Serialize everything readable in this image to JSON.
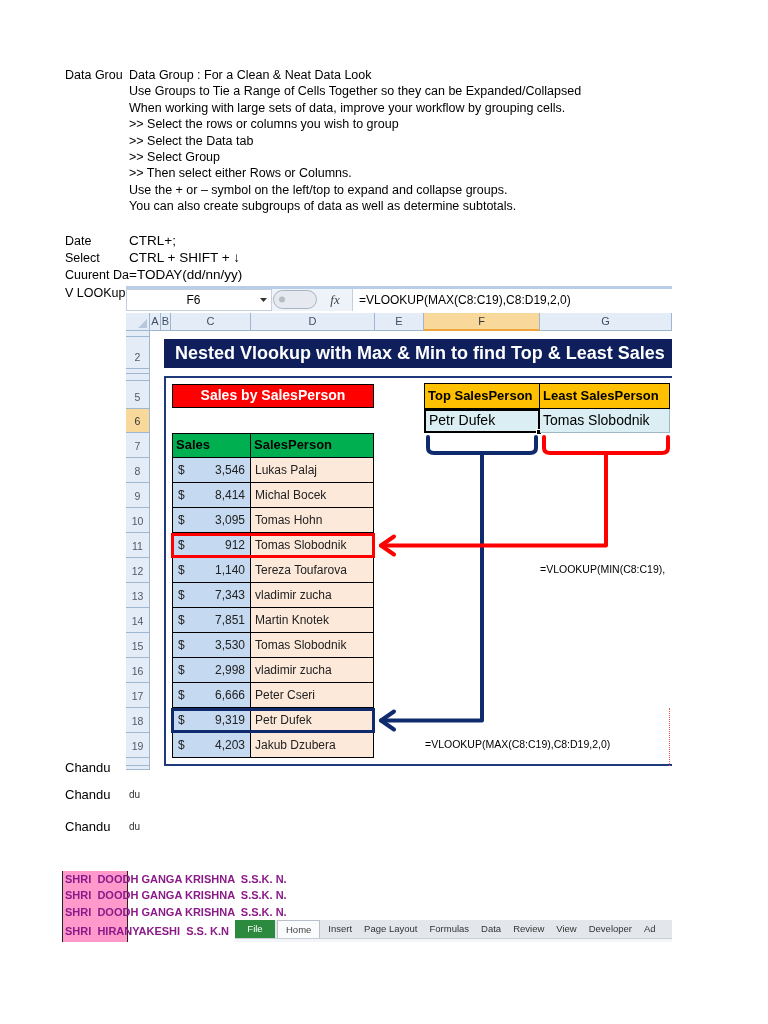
{
  "notes": {
    "label": "Data Grou",
    "lines": [
      "Data Group : For a Clean & Neat Data Look",
      "Use Groups to Tie a Range of Cells Together so they can be Expanded/Collapsed",
      "When working with large sets of data, improve your workflow by grouping cells.",
      ">> Select the rows or columns you wish to group",
      ">> Select the Data tab",
      ">> Select Group",
      ">> Then select either Rows or Columns.",
      "Use the + or – symbol on the left/top to expand and collapse groups.",
      "You can also create subgroups of data as well as determine subtotals."
    ]
  },
  "shortcuts": [
    {
      "label": "Date",
      "value": "CTRL+;"
    },
    {
      "label": "Select",
      "value": "CTRL + SHIFT + ↓"
    },
    {
      "label": "Cuurent Da",
      "value": "=TODAY(dd/nn/yy)"
    }
  ],
  "vlookup_label": "V LOOKup",
  "spreadsheet": {
    "name_box": "F6",
    "function_button": "fx",
    "formula": "=VLOOKUP(MAX(C8:C19),C8:D19,2,0)",
    "column_headers": [
      {
        "label": "A",
        "selected": false
      },
      {
        "label": "B",
        "selected": false
      },
      {
        "label": "C",
        "selected": false
      },
      {
        "label": "D",
        "selected": false
      },
      {
        "label": "E",
        "selected": false
      },
      {
        "label": "F",
        "selected": true
      },
      {
        "label": "G",
        "selected": false
      }
    ],
    "row_headers": [
      {
        "selected": false
      },
      {
        "label": "2",
        "selected": false
      },
      {
        "selected": false
      },
      {
        "selected": false
      },
      {
        "label": "5",
        "selected": false
      },
      {
        "label": "6",
        "selected": true
      },
      {
        "label": "7",
        "selected": false
      },
      {
        "label": "8",
        "selected": false
      },
      {
        "label": "9",
        "selected": false
      },
      {
        "label": "10",
        "selected": false
      },
      {
        "label": "11",
        "selected": false
      },
      {
        "label": "12",
        "selected": false
      },
      {
        "label": "13",
        "selected": false
      },
      {
        "label": "14",
        "selected": false
      },
      {
        "label": "15",
        "selected": false
      },
      {
        "label": "16",
        "selected": false
      },
      {
        "label": "17",
        "selected": false
      },
      {
        "label": "18",
        "selected": false
      },
      {
        "label": "19",
        "selected": false
      },
      {
        "selected": false
      },
      {
        "selected": false
      }
    ],
    "title": "Nested Vlookup with Max & Min to find Top & Least Sales",
    "table_title": "Sales by SalesPerson",
    "table_columns": [
      "Sales",
      "SalesPerson"
    ],
    "rows": [
      {
        "kind": "plain",
        "currency": "$",
        "sales": "3,546",
        "person": "Lukas Palaj"
      },
      {
        "kind": "plain",
        "currency": "$",
        "sales": "8,414",
        "person": "Michal Bocek"
      },
      {
        "kind": "plain",
        "currency": "$",
        "sales": "3,095",
        "person": "Tomas Hohn"
      },
      {
        "kind": "min",
        "currency": "$",
        "sales": "912",
        "person": "Tomas Slobodnik"
      },
      {
        "kind": "plain",
        "currency": "$",
        "sales": "1,140",
        "person": "Tereza Toufarova"
      },
      {
        "kind": "plain",
        "currency": "$",
        "sales": "7,343",
        "person": "vladimir zucha"
      },
      {
        "kind": "plain",
        "currency": "$",
        "sales": "7,851",
        "person": "Martin Knotek"
      },
      {
        "kind": "plain",
        "currency": "$",
        "sales": "3,530",
        "person": "Tomas Slobodnik"
      },
      {
        "kind": "plain",
        "currency": "$",
        "sales": "2,998",
        "person": "vladimir zucha"
      },
      {
        "kind": "plain",
        "currency": "$",
        "sales": "6,666",
        "person": "Peter Cseri"
      },
      {
        "kind": "max",
        "currency": "$",
        "sales": "9,319",
        "person": "Petr Dufek"
      },
      {
        "kind": "plain",
        "currency": "$",
        "sales": "4,203",
        "person": "Jakub Dzubera"
      }
    ],
    "results": [
      {
        "kind": "max",
        "header": "Top SalesPerson",
        "value": "Petr Dufek",
        "selected": true
      },
      {
        "kind": "min",
        "header": "Least SalesPerson",
        "value": "Tomas Slobodnik",
        "selected": false
      }
    ],
    "notes": [
      "=VLOOKUP(MIN(C8:C19),",
      "=VLOOKUP(MAX(C8:C19),C8:D19,2,0)"
    ]
  },
  "footer_rows": [
    {
      "label": "Chandu"
    },
    {
      "label": "Chandu",
      "note": "du"
    },
    {
      "label": "Chandu",
      "note": "du"
    }
  ],
  "highlight_list": [
    "SHRI  DOODH GANGA KRISHNA  S.S.K. N.",
    "SHRI  DOODH GANGA KRISHNA  S.S.K. N.",
    "SHRI  DOODH GANGA KRISHNA  S.S.K. N.",
    "SHRI  HIRANYAKESHI  S.S. K.N"
  ],
  "ribbon": {
    "tabs": [
      {
        "label": "File",
        "kind": "file",
        "selected": false
      },
      {
        "label": "Home",
        "kind": "tab",
        "selected": true
      },
      {
        "label": "Insert",
        "kind": "tab",
        "selected": false
      },
      {
        "label": "Page Layout",
        "kind": "tab",
        "selected": false
      },
      {
        "label": "Formulas",
        "kind": "tab",
        "selected": false
      },
      {
        "label": "Data",
        "kind": "tab",
        "selected": false
      },
      {
        "label": "Review",
        "kind": "tab",
        "selected": false
      },
      {
        "label": "View",
        "kind": "tab",
        "selected": false
      },
      {
        "label": "Developer",
        "kind": "tab",
        "selected": false
      },
      {
        "label": "Ad",
        "kind": "tab",
        "selected": false
      }
    ]
  }
}
